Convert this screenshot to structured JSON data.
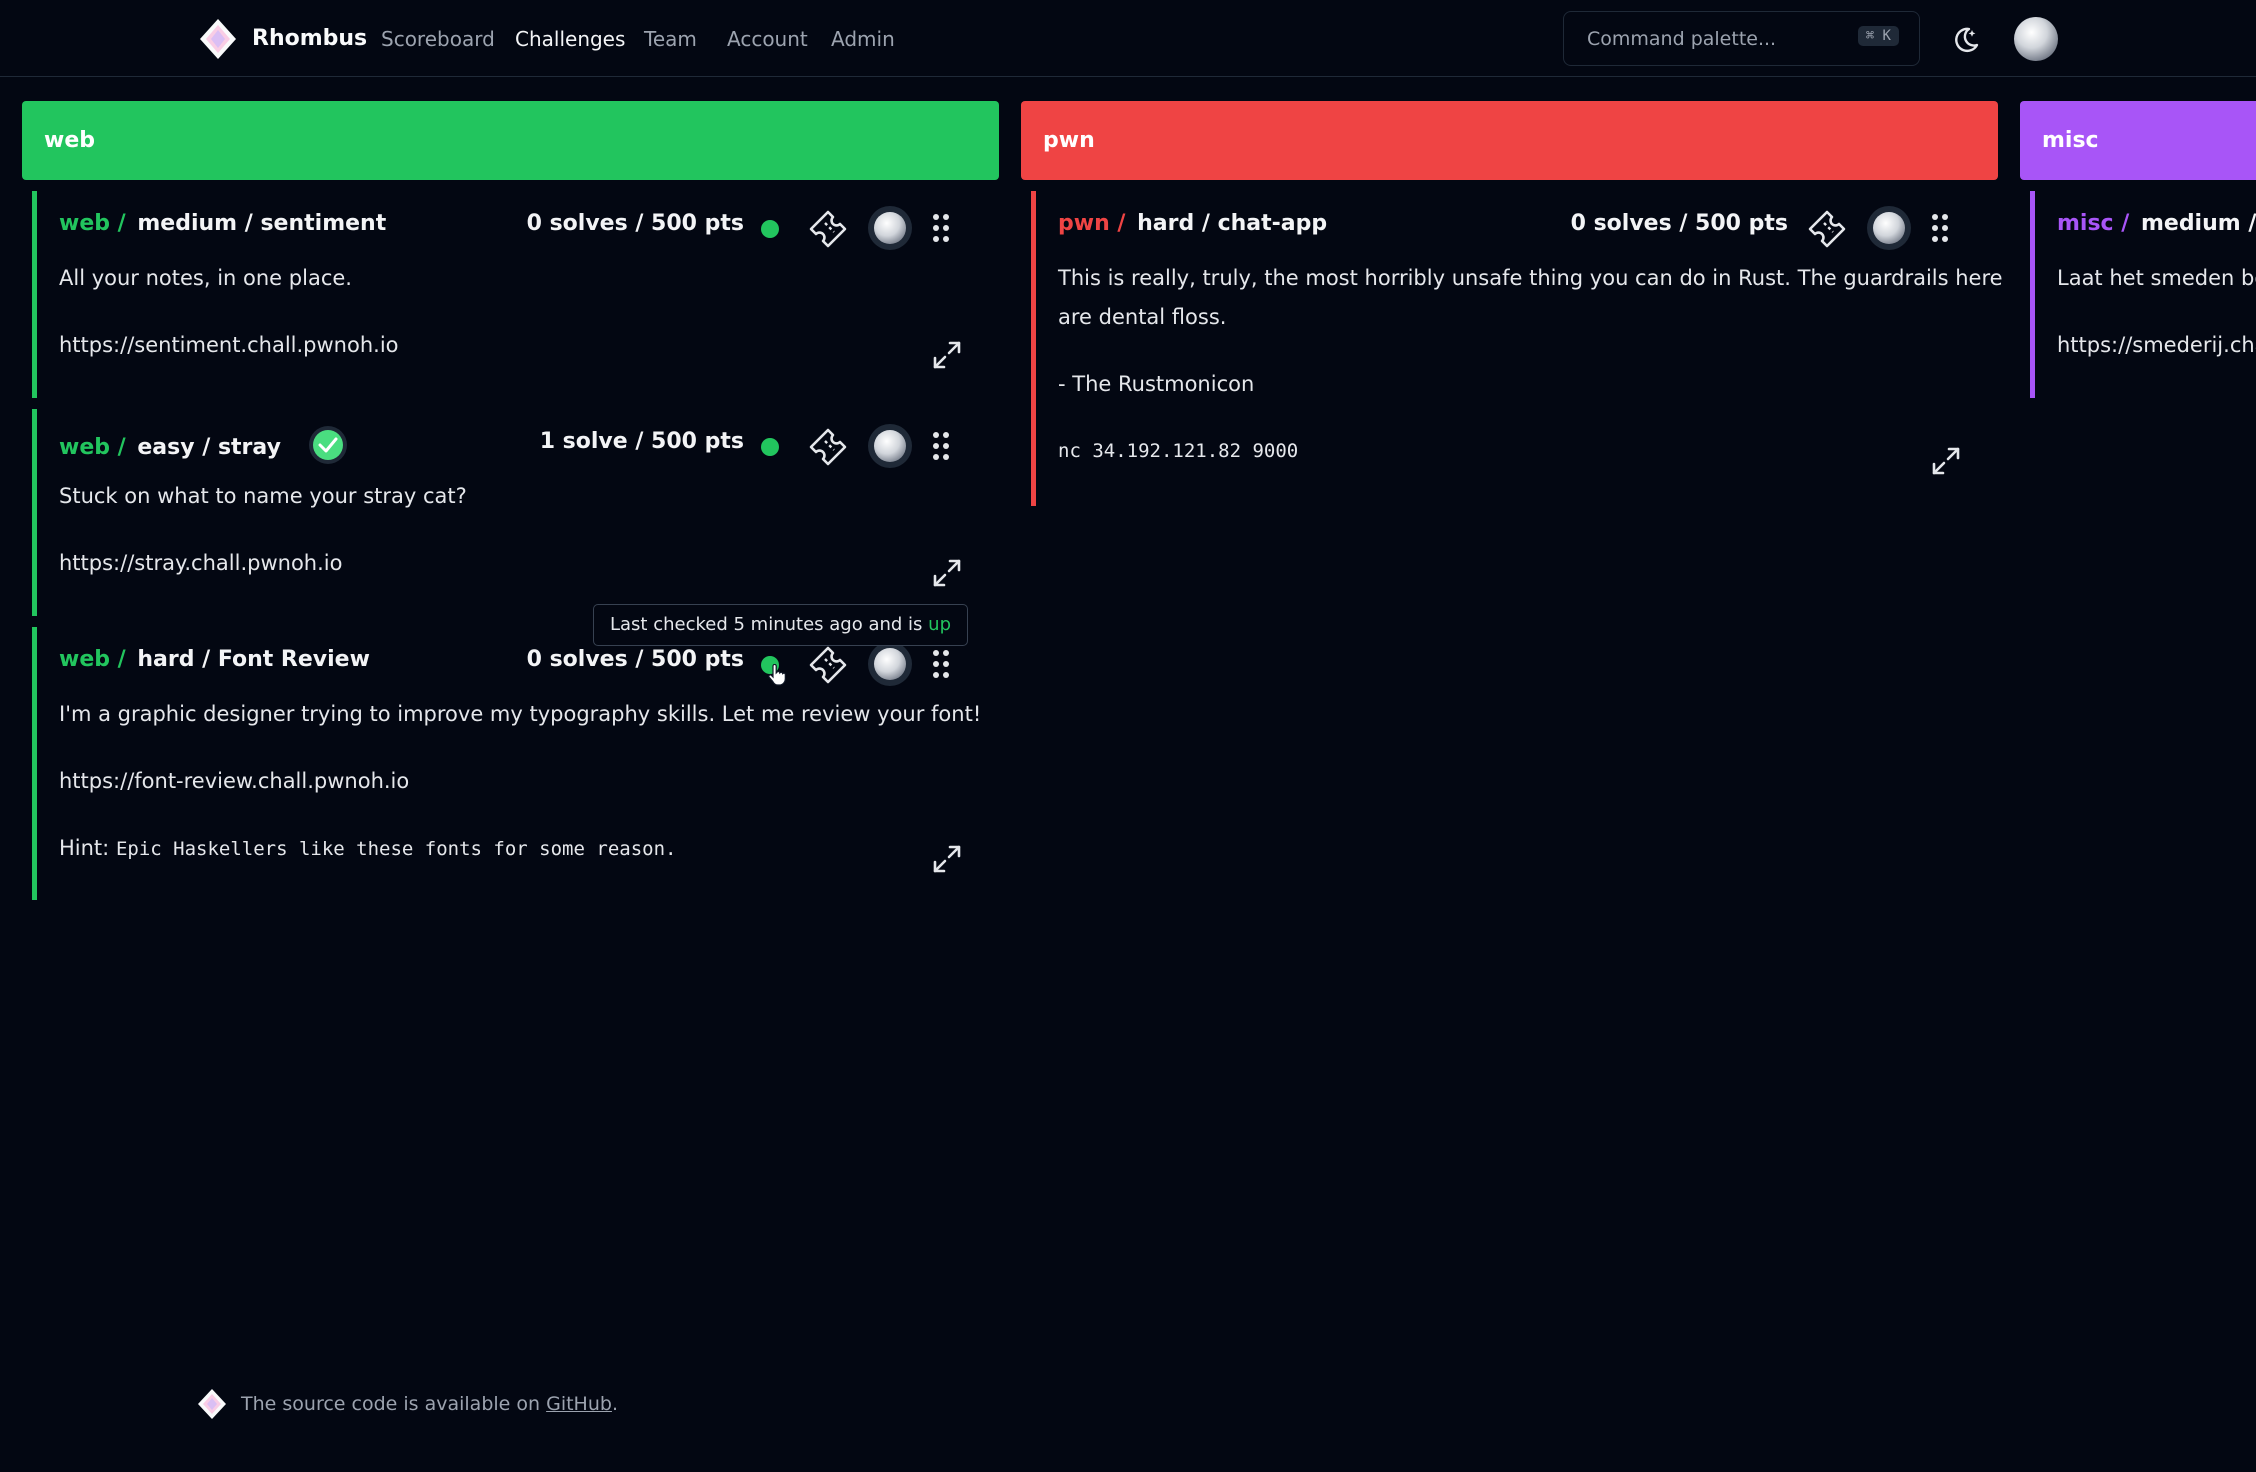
{
  "app": {
    "name": "Rhombus"
  },
  "nav": {
    "links": [
      "Scoreboard",
      "Challenges",
      "Team",
      "Account",
      "Admin"
    ],
    "active": "Challenges"
  },
  "command_palette": {
    "placeholder": "Command palette...",
    "shortcut": "⌘ K"
  },
  "colors": {
    "web": "#22c55e",
    "pwn": "#ef4444",
    "misc": "#a855f7",
    "status_up": "#22c55e"
  },
  "columns": [
    {
      "name": "web",
      "cards": [
        {
          "category": "web /",
          "difficulty": "medium /",
          "name": "sentiment",
          "solves": "0 solves / 500 pts",
          "description": "All your notes, in one place.",
          "link": "https://sentiment.chall.pwnoh.io"
        },
        {
          "category": "web /",
          "difficulty": "easy /",
          "name": "stray",
          "solved": true,
          "solves": "1 solve / 500 pts",
          "description": "Stuck on what to name your stray cat?",
          "link": "https://stray.chall.pwnoh.io"
        },
        {
          "category": "web /",
          "difficulty": "hard /",
          "name": "Font Review",
          "solves": "0 solves / 500 pts",
          "description": "I'm a graphic designer trying to improve my typography skills. Let me review your font!",
          "link": "https://font-review.chall.pwnoh.io",
          "hint_label": "Hint:",
          "hint": "Epic Haskellers like these fonts for some reason."
        }
      ]
    },
    {
      "name": "pwn",
      "cards": [
        {
          "category": "pwn /",
          "difficulty": "hard /",
          "name": "chat-app",
          "solves": "0 solves / 500 pts",
          "description_line1": "This is really, truly, the most horribly unsafe thing you can do in Rust. The guardrails here",
          "description_line2": "are dental floss.",
          "quote": "- The Rustmonicon",
          "connection": "nc 34.192.121.82 9000"
        }
      ]
    },
    {
      "name": "misc",
      "cards": [
        {
          "category": "misc /",
          "difficulty": "medium / sm",
          "description": "Laat het smeden beg",
          "link": "https://smederij.cha"
        }
      ]
    }
  ],
  "tooltip": {
    "text": "Last checked 5 minutes ago and is",
    "status": "up"
  },
  "footer": {
    "text": "The source code is available on",
    "link": "GitHub",
    "suffix": "."
  }
}
